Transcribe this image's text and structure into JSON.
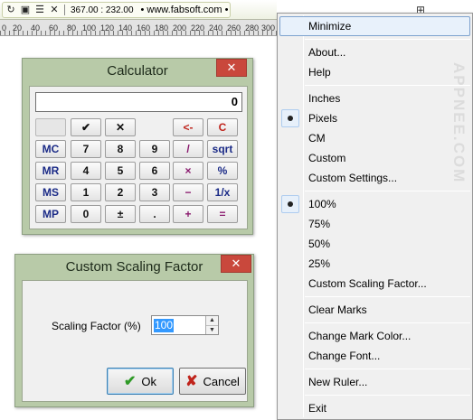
{
  "toolbar": {
    "coords": "367.00 : 232.00",
    "url": "• www.fabsoft.com •"
  },
  "ruler": {
    "tick_labels": [
      "0",
      "20",
      "40",
      "60",
      "80",
      "100",
      "120",
      "140",
      "160",
      "180",
      "200",
      "220",
      "240",
      "260",
      "280",
      "300"
    ]
  },
  "calculator": {
    "title": "Calculator",
    "display": "0",
    "close_label": "✕",
    "rows": [
      [
        "",
        "✔",
        "✕",
        "",
        "<-",
        "C"
      ],
      [
        "MC",
        "7",
        "8",
        "9",
        "/",
        "sqrt"
      ],
      [
        "MR",
        "4",
        "5",
        "6",
        "×",
        "%"
      ],
      [
        "MS",
        "1",
        "2",
        "3",
        "−",
        "1/x"
      ],
      [
        "MP",
        "0",
        "±",
        ".",
        "+",
        "="
      ]
    ]
  },
  "scaling_dialog": {
    "title": "Custom Scaling Factor",
    "close_label": "✕",
    "field_label": "Scaling Factor (%)",
    "field_value": "100",
    "ok_label": "Ok",
    "cancel_label": "Cancel"
  },
  "menu": {
    "watermark": "APPNEE.COM",
    "items": [
      {
        "label": "Minimize"
      },
      {
        "label": "About..."
      },
      {
        "label": "Help"
      },
      {
        "label": "Inches"
      },
      {
        "label": "Pixels",
        "checked": true
      },
      {
        "label": "CM"
      },
      {
        "label": "Custom"
      },
      {
        "label": "Custom Settings..."
      },
      {
        "label": "100%",
        "checked": true
      },
      {
        "label": "75%"
      },
      {
        "label": "50%"
      },
      {
        "label": "25%"
      },
      {
        "label": "Custom Scaling Factor..."
      },
      {
        "label": "Clear Marks"
      },
      {
        "label": "Change Mark Color..."
      },
      {
        "label": "Change Font..."
      },
      {
        "label": "New Ruler..."
      },
      {
        "label": "Exit"
      }
    ]
  },
  "colors": {
    "window_frame": "#b8caa8",
    "close_button": "#c9483c",
    "memory_keys": "#1b2b87",
    "operator_keys": "#8a1a6e",
    "clear_keys": "#c0241c"
  }
}
